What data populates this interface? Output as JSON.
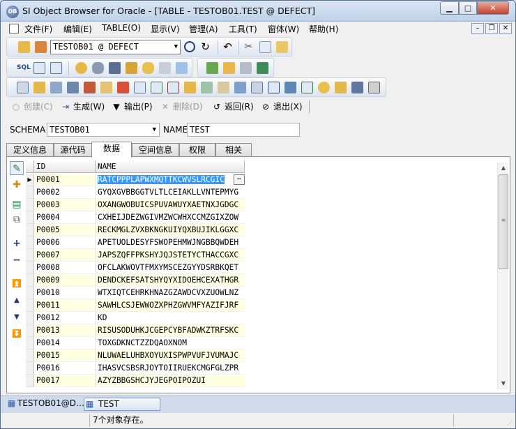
{
  "window": {
    "title": "SI Object Browser for Oracle - [TABLE - TESTOB01.TEST @ DEFECT]",
    "app_icon_text": "OB"
  },
  "menu": {
    "items": [
      "文件(F)",
      "编辑(E)",
      "TABLE(O)",
      "显示(V)",
      "管理(A)",
      "工具(T)",
      "窗体(W)",
      "帮助(H)"
    ]
  },
  "toolbar": {
    "connection": "TESTOB01 @ DEFECT"
  },
  "actions": {
    "create": "创建(C)",
    "generate": "生成(W)",
    "output": "输出(P)",
    "delete": "删除(D)",
    "back": "返回(R)",
    "exit": "退出(X)"
  },
  "object": {
    "schema_label": "SCHEMA",
    "schema_value": "TESTOB01",
    "name_label": "NAME",
    "name_value": "TEST"
  },
  "tabs": [
    "定义信息",
    "源代码",
    "数据",
    "空间信息",
    "权限",
    "相关"
  ],
  "active_tab": 2,
  "grid": {
    "columns": [
      "ID",
      "NAME"
    ],
    "rows": [
      {
        "id": "P0001",
        "name": "RATCPPPLAPWXMQTTKCWVSLRCGIC"
      },
      {
        "id": "P0002",
        "name": "GYQXGVBBGGTVLTLCEIAKLLVNTEPMYG"
      },
      {
        "id": "P0003",
        "name": "OXANGWOBUICSPUVAWUYXAETNXJGDGC"
      },
      {
        "id": "P0004",
        "name": "CXHEIJDEZWGIVMZWCWHXCCMZGIXZOW"
      },
      {
        "id": "P0005",
        "name": "RECKMGLZVXBKNGKUIYQXBUJIKLGGXC"
      },
      {
        "id": "P0006",
        "name": "APETUOLDESYFSWOPEHMWJNGBBQWDEH"
      },
      {
        "id": "P0007",
        "name": "JAPSZQFFPKSHYJQJSTETYCTHACCGXC"
      },
      {
        "id": "P0008",
        "name": "OFCLAKWOVTFMXYMSCEZGYYDSRBKQET"
      },
      {
        "id": "P0009",
        "name": "DENDCKEFSATSHYQYXIDOEHCEXATHGR"
      },
      {
        "id": "P0010",
        "name": "WTXIQTCEHRKHNAZGZAWDCVXZUOWLNZ"
      },
      {
        "id": "P0011",
        "name": "SAWHLCSJEWWOZXPHZGWVMFYAZIFJRF"
      },
      {
        "id": "P0012",
        "name": "KD"
      },
      {
        "id": "P0013",
        "name": "RISUSODUHKJCGEPCYBFADWKZTRFSKC"
      },
      {
        "id": "P0014",
        "name": "TOXGDKNCTZZDQAOXNOM"
      },
      {
        "id": "P0015",
        "name": "NLUWAELUHBXOYUXISPWPVUFJVUMAJC"
      },
      {
        "id": "P0016",
        "name": "IHASVCSBSRJOYTOIIRUEKCMGFGLZPR"
      },
      {
        "id": "P0017",
        "name": "AZYZBBGSHCJYJEGPOIPOZUI"
      }
    ]
  },
  "docbar": {
    "tab1": "TESTOB01@D…",
    "tab2": "TEST"
  },
  "status": {
    "message": "7个对象存在。"
  },
  "colors": {
    "row_highlight": "#ffffe1",
    "selection": "#3399ff",
    "title_gradient_top": "#dbe6f4"
  }
}
